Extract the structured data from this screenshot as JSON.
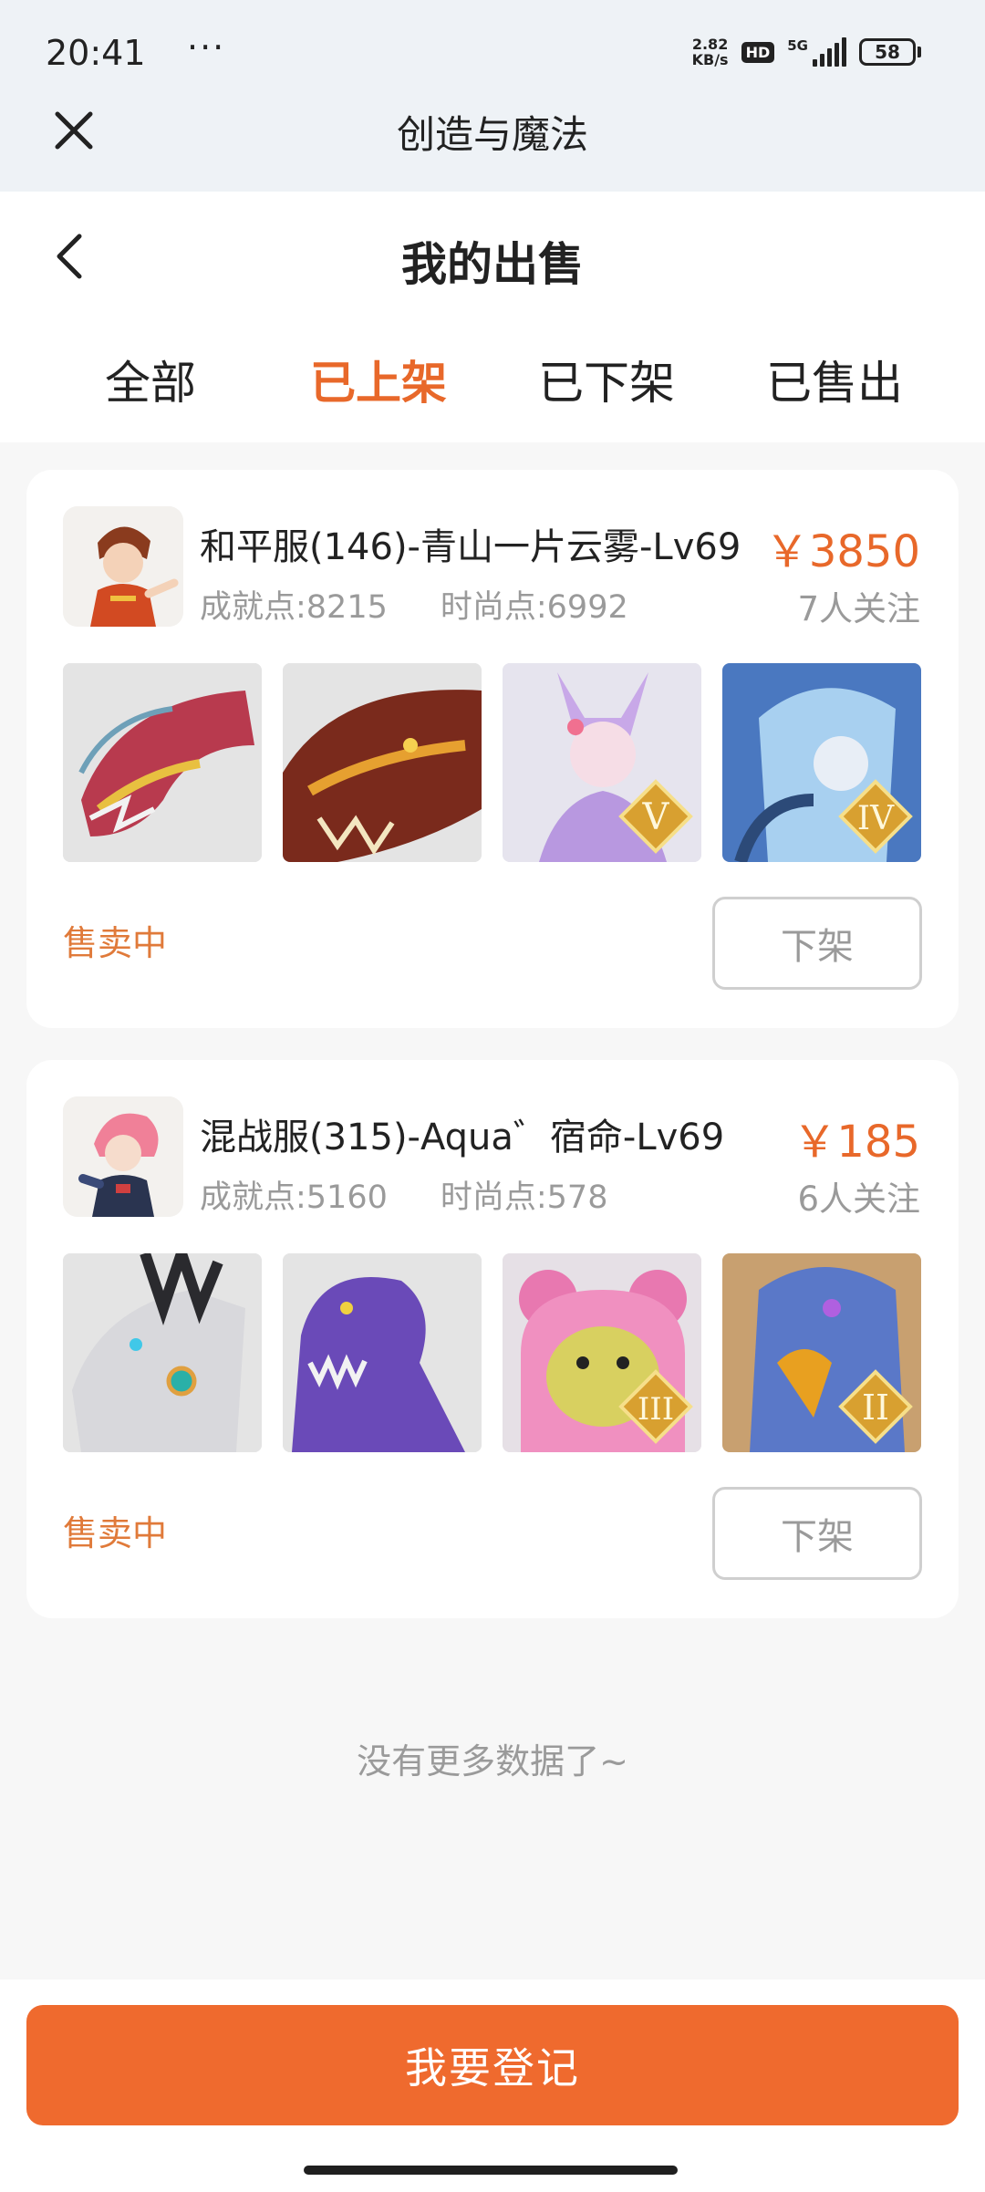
{
  "status_bar": {
    "time": "20:41",
    "dots": "···",
    "net_speed_value": "2.82",
    "net_speed_unit": "KB/s",
    "hd": "HD",
    "signal": "5G",
    "battery": "58"
  },
  "app": {
    "title": "创造与魔法",
    "close_icon": "close-icon"
  },
  "page": {
    "title": "我的出售",
    "back_icon": "chevron-left-icon"
  },
  "tabs": [
    {
      "label": "全部",
      "active": false
    },
    {
      "label": "已上架",
      "active": true
    },
    {
      "label": "已下架",
      "active": false
    },
    {
      "label": "已售出",
      "active": false
    }
  ],
  "listings": [
    {
      "name": "和平服(146)-青山一片云雾-Lv69",
      "achievement": "成就点:8215",
      "fashion": "时尚点:6992",
      "price": "￥3850",
      "follows": "7人关注",
      "items": [
        {
          "desc": "dragon",
          "tier": ""
        },
        {
          "desc": "fire-dragon",
          "tier": ""
        },
        {
          "desc": "fox-girl",
          "tier": "V"
        },
        {
          "desc": "ice-warrior",
          "tier": "IV"
        }
      ],
      "status": "售卖中",
      "action": "下架"
    },
    {
      "name": "混战服(315)-Aqua゛宿命-Lv69",
      "achievement": "成就点:5160",
      "fashion": "时尚点:578",
      "price": "￥185",
      "follows": "6人关注",
      "items": [
        {
          "desc": "mech-wolf",
          "tier": ""
        },
        {
          "desc": "purple-dino",
          "tier": ""
        },
        {
          "desc": "pink-bear",
          "tier": "III"
        },
        {
          "desc": "griffin",
          "tier": "II"
        }
      ],
      "status": "售卖中",
      "action": "下架"
    }
  ],
  "footer": {
    "no_more": "没有更多数据了~",
    "register": "我要登记"
  },
  "colors": {
    "accent": "#e8682a",
    "button": "#ef6a2e",
    "muted": "#9a9a9a"
  }
}
